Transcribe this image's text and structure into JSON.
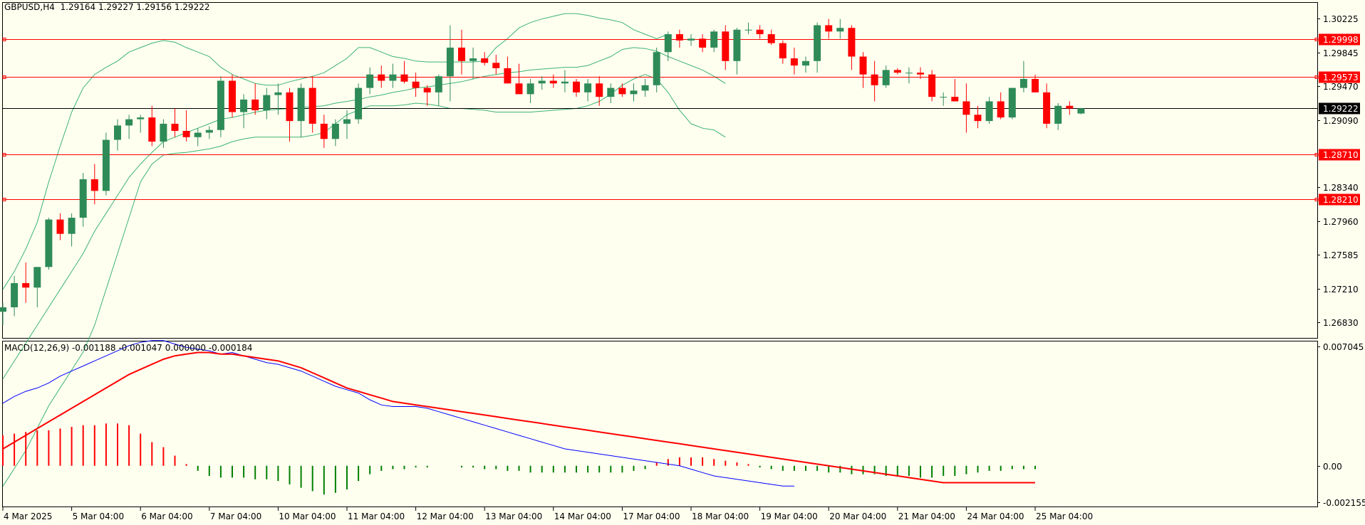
{
  "chart_header": {
    "symbol": "GBPUSD,H4",
    "ohlc": "1.29164 1.29227 1.29156 1.29222"
  },
  "macd_header": "MACD(12,26,9) -0.001188 -0.001047 0.000000 -0.000184",
  "colors": {
    "background": "#fffff0",
    "bull": "#2e8b57",
    "bear": "#ff0000",
    "bollinger": "#3cb371",
    "hline": "#ff0000",
    "current_line": "#000000",
    "macd_line": "#0000ff",
    "signal_line": "#ff0000",
    "hist_pos": "#ff0000",
    "hist_neg": "#008000"
  },
  "chart_data": [
    {
      "type": "candlestick",
      "title": "GBPUSD,H4",
      "ylim": [
        1.2665,
        1.304
      ],
      "y_ticks": [
        1.30225,
        1.29845,
        1.2947,
        1.2909,
        1.2834,
        1.2796,
        1.27585,
        1.2721,
        1.2683
      ],
      "y_tick_labels": [
        "1.30225",
        "1.29845",
        "1.29470",
        "1.29090",
        "1.28340",
        "1.27960",
        "1.27585",
        "1.27210",
        "1.26830"
      ],
      "x_labels": [
        "4 Mar 2025",
        "5 Mar 04:00",
        "6 Mar 04:00",
        "7 Mar 04:00",
        "10 Mar 04:00",
        "11 Mar 04:00",
        "12 Mar 04:00",
        "13 Mar 04:00",
        "14 Mar 04:00",
        "17 Mar 04:00",
        "18 Mar 04:00",
        "19 Mar 04:00",
        "20 Mar 04:00",
        "21 Mar 04:00",
        "24 Mar 04:00",
        "25 Mar 04:00"
      ],
      "x_label_index": [
        0,
        6,
        12,
        18,
        24,
        30,
        36,
        42,
        48,
        54,
        60,
        66,
        72,
        78,
        84,
        90
      ],
      "horizontal_levels": [
        {
          "value": 1.29998,
          "label": "1.29998"
        },
        {
          "value": 1.29573,
          "label": "1.29573"
        },
        {
          "value": 1.2871,
          "label": "1.28710"
        },
        {
          "value": 1.2821,
          "label": "1.28210"
        }
      ],
      "current_price": {
        "value": 1.29222,
        "label": "1.29222"
      },
      "ohlc": [
        [
          1.2695,
          1.2705,
          1.268,
          1.27
        ],
        [
          1.27,
          1.2735,
          1.269,
          1.2727
        ],
        [
          1.2727,
          1.275,
          1.2705,
          1.2722
        ],
        [
          1.2722,
          1.2745,
          1.27,
          1.2745
        ],
        [
          1.2745,
          1.28,
          1.2742,
          1.2798
        ],
        [
          1.2798,
          1.2805,
          1.2775,
          1.2782
        ],
        [
          1.2782,
          1.2805,
          1.2768,
          1.28
        ],
        [
          1.28,
          1.285,
          1.279,
          1.2843
        ],
        [
          1.2843,
          1.286,
          1.2815,
          1.283
        ],
        [
          1.283,
          1.2895,
          1.2825,
          1.2887
        ],
        [
          1.2887,
          1.291,
          1.2875,
          1.2903
        ],
        [
          1.2903,
          1.2915,
          1.2888,
          1.291
        ],
        [
          1.291,
          1.2915,
          1.2895,
          1.2912
        ],
        [
          1.2912,
          1.2925,
          1.288,
          1.2885
        ],
        [
          1.2885,
          1.291,
          1.2878,
          1.2905
        ],
        [
          1.2905,
          1.2922,
          1.289,
          1.2897
        ],
        [
          1.2897,
          1.292,
          1.2885,
          1.289
        ],
        [
          1.289,
          1.29,
          1.288,
          1.2895
        ],
        [
          1.2895,
          1.2902,
          1.2888,
          1.2898
        ],
        [
          1.2898,
          1.2958,
          1.289,
          1.2953
        ],
        [
          1.2953,
          1.296,
          1.2912,
          1.2918
        ],
        [
          1.2918,
          1.2938,
          1.29,
          1.2932
        ],
        [
          1.2932,
          1.295,
          1.2915,
          1.292
        ],
        [
          1.292,
          1.2945,
          1.291,
          1.2937
        ],
        [
          1.2937,
          1.295,
          1.2915,
          1.294
        ],
        [
          1.294,
          1.2945,
          1.2885,
          1.2908
        ],
        [
          1.2908,
          1.295,
          1.289,
          1.2945
        ],
        [
          1.2945,
          1.2958,
          1.2895,
          1.2905
        ],
        [
          1.2905,
          1.2915,
          1.2878,
          1.2888
        ],
        [
          1.2888,
          1.291,
          1.288,
          1.2905
        ],
        [
          1.2905,
          1.292,
          1.2888,
          1.291
        ],
        [
          1.291,
          1.295,
          1.2905,
          1.2945
        ],
        [
          1.2945,
          1.2968,
          1.2938,
          1.296
        ],
        [
          1.296,
          1.297,
          1.2945,
          1.2953
        ],
        [
          1.2953,
          1.2972,
          1.2945,
          1.296
        ],
        [
          1.296,
          1.2975,
          1.295,
          1.2952
        ],
        [
          1.2952,
          1.2962,
          1.2935,
          1.2945
        ],
        [
          1.2945,
          1.2948,
          1.2925,
          1.294
        ],
        [
          1.294,
          1.296,
          1.2925,
          1.2958
        ],
        [
          1.2958,
          1.3015,
          1.293,
          1.299
        ],
        [
          1.299,
          1.301,
          1.296,
          1.2975
        ],
        [
          1.2975,
          1.299,
          1.2955,
          1.2978
        ],
        [
          1.2978,
          1.2985,
          1.297,
          1.2973
        ],
        [
          1.2973,
          1.2982,
          1.296,
          1.2967
        ],
        [
          1.2967,
          1.298,
          1.295,
          1.295
        ],
        [
          1.295,
          1.2972,
          1.2938,
          1.2938
        ],
        [
          1.2938,
          1.2955,
          1.2928,
          1.295
        ],
        [
          1.295,
          1.2958,
          1.2943,
          1.2953
        ],
        [
          1.2953,
          1.296,
          1.2945,
          1.295
        ],
        [
          1.295,
          1.2965,
          1.294,
          1.2952
        ],
        [
          1.2952,
          1.2955,
          1.2935,
          1.294
        ],
        [
          1.294,
          1.2955,
          1.293,
          1.295
        ],
        [
          1.295,
          1.2958,
          1.2925,
          1.2935
        ],
        [
          1.2935,
          1.295,
          1.2928,
          1.2945
        ],
        [
          1.2945,
          1.295,
          1.2935,
          1.2938
        ],
        [
          1.2938,
          1.295,
          1.293,
          1.2942
        ],
        [
          1.2942,
          1.2955,
          1.2935,
          1.2948
        ],
        [
          1.2948,
          1.299,
          1.294,
          1.2985
        ],
        [
          1.2985,
          1.3008,
          1.2975,
          1.3005
        ],
        [
          1.3005,
          1.301,
          1.299,
          1.2998
        ],
        [
          1.2998,
          1.3005,
          1.2992,
          1.3
        ],
        [
          1.3,
          1.3005,
          1.2985,
          1.299
        ],
        [
          1.299,
          1.301,
          1.2985,
          1.3008
        ],
        [
          1.3008,
          1.3015,
          1.2965,
          1.2975
        ],
        [
          1.2975,
          1.3012,
          1.296,
          1.301
        ],
        [
          1.301,
          1.3018,
          1.3005,
          1.301
        ],
        [
          1.301,
          1.3015,
          1.3,
          1.3005
        ],
        [
          1.3005,
          1.301,
          1.2993,
          1.2995
        ],
        [
          1.2995,
          1.2998,
          1.2972,
          1.2978
        ],
        [
          1.2978,
          1.299,
          1.296,
          1.297
        ],
        [
          1.297,
          1.298,
          1.2962,
          1.2975
        ],
        [
          1.2975,
          1.3018,
          1.2962,
          1.3015
        ],
        [
          1.3015,
          1.3022,
          1.3,
          1.3008
        ],
        [
          1.3008,
          1.3022,
          1.3,
          1.3012
        ],
        [
          1.3012,
          1.3015,
          1.2965,
          1.298
        ],
        [
          1.298,
          1.2985,
          1.2945,
          1.296
        ],
        [
          1.296,
          1.2975,
          1.293,
          1.2948
        ],
        [
          1.2948,
          1.297,
          1.2945,
          1.2965
        ],
        [
          1.2965,
          1.2967,
          1.296,
          1.2962
        ],
        [
          1.2962,
          1.2968,
          1.295,
          1.2962
        ],
        [
          1.2962,
          1.2968,
          1.2955,
          1.296
        ],
        [
          1.296,
          1.2965,
          1.293,
          1.2935
        ],
        [
          1.2935,
          1.294,
          1.2925,
          1.2935
        ],
        [
          1.2935,
          1.2955,
          1.293,
          1.293
        ],
        [
          1.293,
          1.295,
          1.2895,
          1.2915
        ],
        [
          1.2915,
          1.2925,
          1.29,
          1.2908
        ],
        [
          1.2908,
          1.2935,
          1.2905,
          1.293
        ],
        [
          1.293,
          1.294,
          1.291,
          1.2912
        ],
        [
          1.2912,
          1.2945,
          1.291,
          1.2945
        ],
        [
          1.2945,
          1.2975,
          1.294,
          1.2955
        ],
        [
          1.2955,
          1.296,
          1.294,
          1.294
        ],
        [
          1.294,
          1.295,
          1.29,
          1.2905
        ],
        [
          1.2905,
          1.2928,
          1.2898,
          1.2925
        ],
        [
          1.2925,
          1.293,
          1.2915,
          1.2922
        ],
        [
          1.29164,
          1.29227,
          1.29156,
          1.29222
        ]
      ],
      "bollinger": {
        "upper": [
          1.272,
          1.274,
          1.2765,
          1.2795,
          1.284,
          1.288,
          1.2918,
          1.2945,
          1.296,
          1.2968,
          1.2975,
          1.2985,
          1.299,
          1.2995,
          1.2998,
          1.2996,
          1.299,
          1.2985,
          1.298,
          1.2968,
          1.296,
          1.2955,
          1.295,
          1.2948,
          1.2948,
          1.2952,
          1.2955,
          1.2958,
          1.2962,
          1.297,
          1.2978,
          1.299,
          1.299,
          1.2985,
          1.298,
          1.2978,
          1.2975,
          1.2974,
          1.2974,
          1.2974,
          1.2974,
          1.2974,
          1.2975,
          1.299,
          1.3,
          1.3012,
          1.3018,
          1.3022,
          1.3025,
          1.3028,
          1.3028,
          1.3026,
          1.3023,
          1.3021,
          1.3018,
          1.301,
          1.3005,
          1.3,
          1.3005
        ],
        "middle": [
          1.262,
          1.264,
          1.266,
          1.268,
          1.27,
          1.272,
          1.274,
          1.276,
          1.2785,
          1.2805,
          1.2825,
          1.2845,
          1.286,
          1.2873,
          1.2885,
          1.289,
          1.2895,
          1.29,
          1.2905,
          1.291,
          1.2912,
          1.2915,
          1.2918,
          1.292,
          1.2921,
          1.2922,
          1.2923,
          1.2924,
          1.2925,
          1.2928,
          1.293,
          1.2932,
          1.2935,
          1.2937,
          1.294,
          1.2942,
          1.2945,
          1.2946,
          1.2948,
          1.295,
          1.2952,
          1.2955,
          1.2958,
          1.296,
          1.2962,
          1.2963,
          1.2965,
          1.2966,
          1.2967,
          1.2968,
          1.2968,
          1.297,
          1.2975,
          1.298,
          1.2988,
          1.299,
          1.2989,
          1.2986,
          1.298,
          1.2975,
          1.297,
          1.2965,
          1.2958,
          1.295
        ],
        "lower": [
          1.25,
          1.252,
          1.254,
          1.2565,
          1.259,
          1.261,
          1.263,
          1.265,
          1.268,
          1.272,
          1.276,
          1.28,
          1.284,
          1.286,
          1.287,
          1.2872,
          1.2873,
          1.2875,
          1.2877,
          1.288,
          1.2885,
          1.2888,
          1.289,
          1.289,
          1.289,
          1.289,
          1.289,
          1.2892,
          1.2895,
          1.2905,
          1.2915,
          1.292,
          1.2925,
          1.2925,
          1.2925,
          1.2926,
          1.2928,
          1.2927,
          1.2925,
          1.2922,
          1.2922,
          1.2921,
          1.292,
          1.2918,
          1.2918,
          1.2918,
          1.2918,
          1.2919,
          1.292,
          1.2921,
          1.2922,
          1.2925,
          1.293,
          1.2938,
          1.2948,
          1.2955,
          1.296,
          1.2955,
          1.294,
          1.292,
          1.2905,
          1.29,
          1.2898,
          1.289
        ]
      }
    },
    {
      "type": "macd",
      "title": "MACD(12,26,9) -0.001188 -0.001047 0.000000 -0.000184",
      "ylim": [
        -0.00245,
        0.00735
      ],
      "y_ticks": [
        0.007045,
        0.0,
        -0.002155
      ],
      "y_tick_labels": [
        "0.007045",
        "0.00",
        "-0.002155"
      ],
      "macd": [
        0.0037,
        0.0041,
        0.0044,
        0.0046,
        0.0049,
        0.0053,
        0.0056,
        0.0059,
        0.0062,
        0.0065,
        0.0068,
        0.0071,
        0.0073,
        0.0074,
        0.0074,
        0.0072,
        0.007,
        0.0069,
        0.0068,
        0.0066,
        0.0067,
        0.0065,
        0.0063,
        0.0061,
        0.006,
        0.0058,
        0.0056,
        0.0053,
        0.005,
        0.0047,
        0.0045,
        0.0043,
        0.0039,
        0.0036,
        0.0035,
        0.0035,
        0.0035,
        0.0034,
        0.0032,
        0.003,
        0.0028,
        0.0026,
        0.0024,
        0.0022,
        0.002,
        0.0018,
        0.0016,
        0.0014,
        0.0012,
        0.001,
        0.0009,
        0.0008,
        0.0007,
        0.0006,
        0.0005,
        0.0004,
        0.0003,
        0.0002,
        0.0001,
        0.0,
        -0.0002,
        -0.0004,
        -0.0006,
        -0.0007,
        -0.0008,
        -0.0009,
        -0.001,
        -0.0011,
        -0.0012,
        -0.0012
      ],
      "signal": [
        0.001,
        0.0014,
        0.0018,
        0.0022,
        0.0026,
        0.003,
        0.0034,
        0.0038,
        0.0042,
        0.0046,
        0.005,
        0.0054,
        0.0057,
        0.006,
        0.0063,
        0.0065,
        0.0066,
        0.0067,
        0.0067,
        0.0066,
        0.0066,
        0.0065,
        0.0064,
        0.0063,
        0.0062,
        0.006,
        0.0058,
        0.0055,
        0.0052,
        0.0049,
        0.0046,
        0.0044,
        0.0042,
        0.004,
        0.0038,
        0.0037,
        0.0036,
        0.0035,
        0.0034,
        0.0033,
        0.0032,
        0.0031,
        0.003,
        0.0029,
        0.0028,
        0.0027,
        0.0026,
        0.0025,
        0.0024,
        0.0023,
        0.0022,
        0.0021,
        0.002,
        0.0019,
        0.0018,
        0.0017,
        0.0016,
        0.0015,
        0.0014,
        0.0013,
        0.0012,
        0.0011,
        0.001,
        0.0009,
        0.0008,
        0.0007,
        0.0006,
        0.0005,
        0.0004,
        0.0003,
        0.0002,
        0.0001,
        0.0,
        -0.0001,
        -0.0002,
        -0.0003,
        -0.0004,
        -0.0005,
        -0.0006,
        -0.0007,
        -0.0008,
        -0.0009,
        -0.001,
        -0.001,
        -0.001,
        -0.001,
        -0.001,
        -0.001,
        -0.001,
        -0.001,
        -0.001
      ],
      "histogram": [
        0.0018,
        0.0019,
        0.002,
        0.0021,
        0.0021,
        0.0022,
        0.0023,
        0.0024,
        0.0024,
        0.0025,
        0.0025,
        0.0024,
        0.0019,
        0.0014,
        0.0011,
        0.0006,
        0.0001,
        -0.0003,
        -0.0006,
        -0.0007,
        -0.0007,
        -0.0007,
        -0.0008,
        -0.0008,
        -0.0009,
        -0.0011,
        -0.0013,
        -0.0015,
        -0.0017,
        -0.0016,
        -0.0014,
        -0.0009,
        -0.0005,
        -0.0003,
        -0.0002,
        -0.0002,
        -0.0001,
        -0.0001,
        0.0,
        0.0,
        -0.0001,
        -0.0001,
        -0.0002,
        -0.0002,
        -0.0003,
        -0.0003,
        -0.0004,
        -0.0004,
        -0.0004,
        -0.0004,
        -0.0004,
        -0.0004,
        -0.0004,
        -0.0004,
        -0.0004,
        -0.0003,
        -0.0002,
        0.0002,
        0.0004,
        0.0005,
        0.0005,
        0.0005,
        0.0004,
        0.0003,
        0.0002,
        0.0001,
        -0.0001,
        -0.0002,
        -0.0003,
        -0.0003,
        -0.0003,
        -0.0003,
        -0.0004,
        -0.0004,
        -0.0005,
        -0.0005,
        -0.0005,
        -0.0006,
        -0.0006,
        -0.0006,
        -0.0007,
        -0.0007,
        -0.0006,
        -0.0006,
        -0.0005,
        -0.0004,
        -0.0003,
        -0.0003,
        -0.0002,
        -0.0002,
        -0.0002
      ]
    }
  ]
}
